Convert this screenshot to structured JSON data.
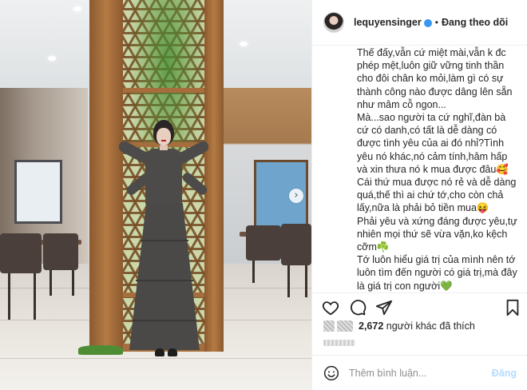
{
  "header": {
    "username": "lequyensinger",
    "separator": "•",
    "follow_status": "Đang theo dõi"
  },
  "caption": {
    "paragraphs": [
      "Thế đấy,vẫn cứ miệt mài,vẫn k đc phép mệt,luôn giữ vững tinh thần cho đôi chân ko mỏi,làm gì có sự thành công nào được dâng lên sẵn như mâm cỗ ngon...",
      "Mà...sao người ta cứ nghĩ,đàn bà cứ có danh,có tất là dễ dàng có được tình yêu của ai đó nhỉ?Tình yêu nó khác,nó cảm tính,hâm hấp và xin thưa nó k mua được đâu🥰",
      "Cái thứ mua được nó rẻ và dễ dàng quá,thế thì ai chứ tớ,cho còn chả lấy,nữa là phải bỏ tiền mua😝",
      "Phải yêu và xứng đáng được yêu,tự nhiên mọi thứ sẽ vừa vặn,ko kệch cỡm☘️",
      "Tớ luôn hiểu giá trị của mình nên tớ luôn tìm đến người có giá trị,mà đây là giá trị con người💚"
    ]
  },
  "likes": {
    "count": "2,672",
    "text": "người khác đã thích"
  },
  "comment": {
    "placeholder": "Thêm bình luận...",
    "post_label": "Đăng"
  },
  "icons": {
    "heart": "heart-icon",
    "comment": "comment-icon",
    "share": "share-icon",
    "save": "bookmark-icon",
    "emoji": "emoji-icon",
    "next": "chevron-right-icon"
  },
  "colors": {
    "text": "#262626",
    "muted": "#8e8e8e",
    "verified": "#3897f0",
    "post_button": "#b3dbff",
    "border": "#efefef"
  }
}
